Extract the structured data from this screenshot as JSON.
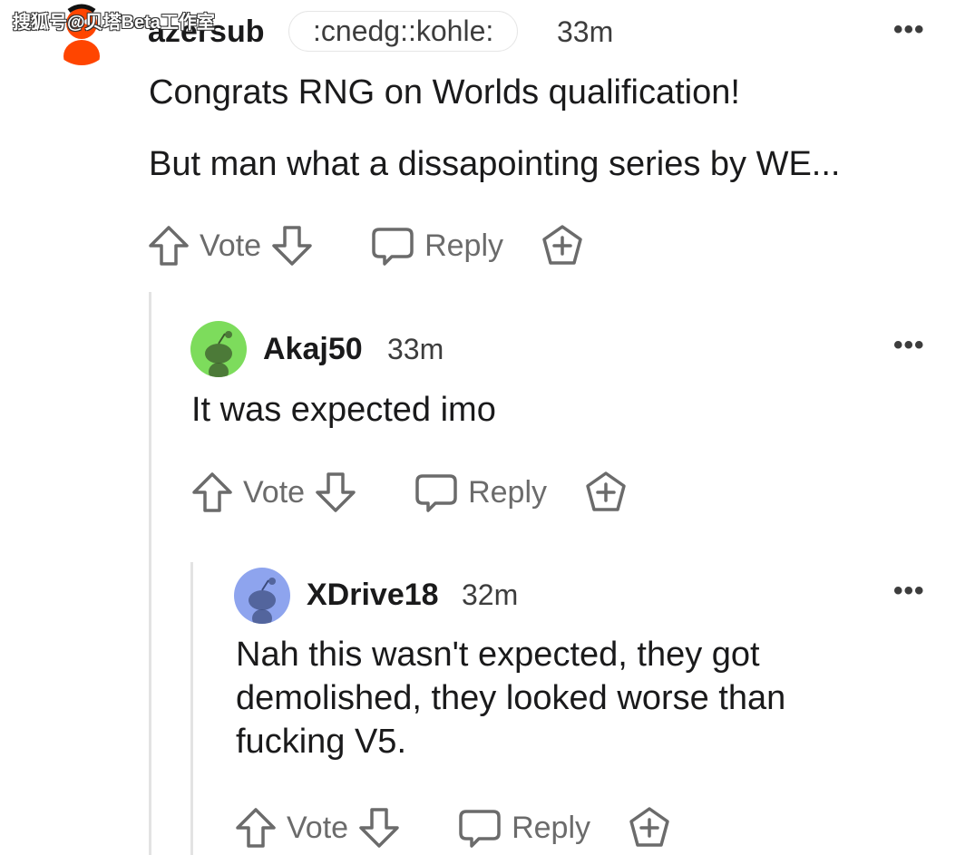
{
  "watermark": "搜狐号@贝塔Beta工作室",
  "comments": [
    {
      "username": "azersub",
      "flair": ":cnedg::kohle:",
      "time": "33m",
      "menu": "•••",
      "body": [
        "Congrats RNG on Worlds qualification!",
        "But man what a dissapointing series by WE..."
      ],
      "vote_label": "Vote",
      "reply_label": "Reply",
      "avatar_color": "#ff4500"
    },
    {
      "username": "Akaj50",
      "time": "33m",
      "menu": "•••",
      "body": [
        "It was expected imo"
      ],
      "vote_label": "Vote",
      "reply_label": "Reply",
      "avatar_color": "#7ddc5c"
    },
    {
      "username": "XDrive18",
      "time": "32m",
      "menu": "•••",
      "body": [
        "Nah this wasn't expected, they got demolished, they looked worse than fucking V5."
      ],
      "vote_label": "Vote",
      "reply_label": "Reply",
      "avatar_color": "#8ea4ee"
    }
  ]
}
